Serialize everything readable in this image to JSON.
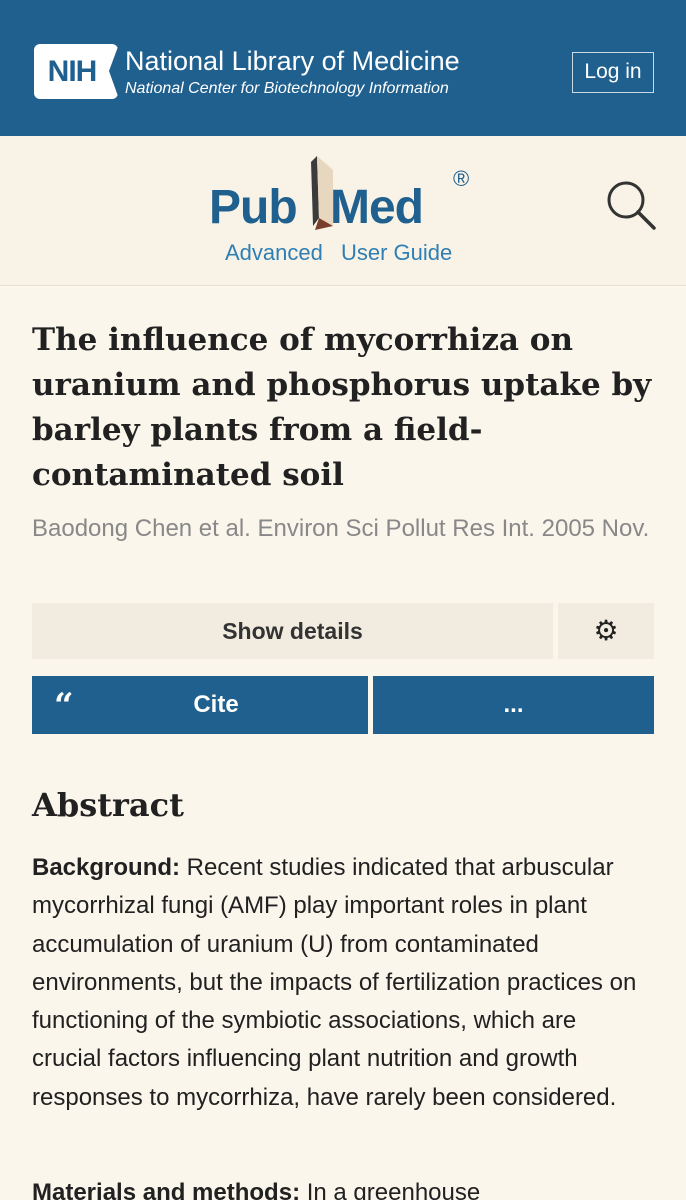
{
  "nih_header": {
    "logo_text": "NIH",
    "title": "National Library of Medicine",
    "subtitle": "National Center for Biotechnology Information",
    "login_label": "Log in",
    "background_color": "#20608f"
  },
  "pubmed": {
    "logo_pub": "Pub",
    "logo_med": "Med",
    "registered_mark": "®",
    "advanced_link": "Advanced",
    "user_guide_link": "User Guide",
    "search_icon": "search-icon"
  },
  "article": {
    "title": "The influence of mycorrhiza on uranium and phosphorus uptake by barley plants from a field-contaminated soil",
    "citation": "Baodong Chen et al. Environ Sci Pollut Res Int. 2005 Nov.",
    "show_details_label": "Show details",
    "settings_icon": "gear-icon",
    "cite_quote_icon": "“",
    "cite_label": "Cite",
    "more_label": "...",
    "accent_color": "#20608f"
  },
  "abstract": {
    "heading": "Abstract",
    "background_label": "Background:",
    "background_text": " Recent studies indicated that arbuscular mycorrhizal fungi (AMF) play important roles in plant accumulation of uranium (U) from contaminated environments, but the impacts of fertilization practices on functioning of the symbiotic associations, which are crucial factors influencing plant nutrition and growth responses to mycorrhiza, have rarely been considered.",
    "methods_label": "Materials and methods:",
    "methods_text": " In a greenhouse"
  }
}
